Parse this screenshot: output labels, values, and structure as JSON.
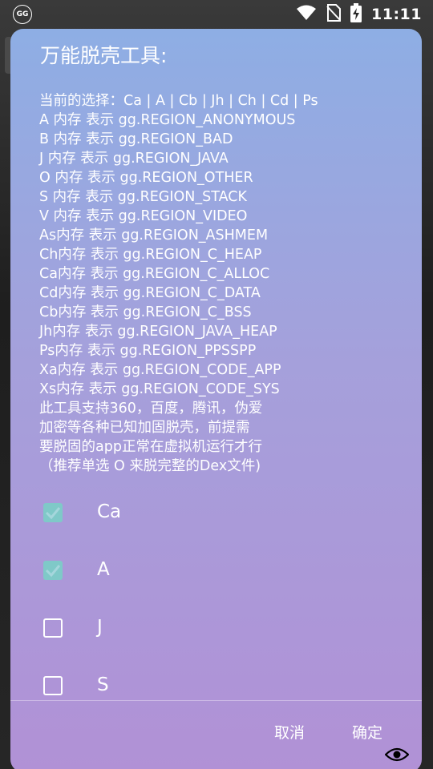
{
  "status_bar": {
    "app_badge": "GG",
    "time": "11:11",
    "icons": [
      "wifi-icon",
      "no-sim-icon",
      "battery-charging-icon"
    ]
  },
  "dialog": {
    "title": "万能脱壳工具:",
    "message_lines": [
      "当前的选择：Ca | A | Cb | Jh | Ch | Cd | Ps",
      "A 内存 表示 gg.REGION_ANONYMOUS",
      "B 内存 表示 gg.REGION_BAD",
      "J 内存 表示 gg.REGION_JAVA",
      "O 内存 表示 gg.REGION_OTHER",
      "S 内存 表示 gg.REGION_STACK",
      "V 内存 表示 gg.REGION_VIDEO",
      "As内存 表示 gg.REGION_ASHMEM",
      "Ch内存 表示 gg.REGION_C_HEAP",
      "Ca内存 表示 gg.REGION_C_ALLOC",
      "Cd内存 表示 gg.REGION_C_DATA",
      "Cb内存 表示 gg.REGION_C_BSS",
      "Jh内存 表示 gg.REGION_JAVA_HEAP",
      "Ps内存 表示 gg.REGION_PPSSPP",
      "Xa内存 表示 gg.REGION_CODE_APP",
      "Xs内存 表示 gg.REGION_CODE_SYS",
      "此工具支持360，百度，腾讯，伪爱",
      "加密等各种已知加固脱壳，前提需",
      "要脱固的app正常在虚拟机运行才行",
      "（推荐单选 O 来脱完整的Dex文件)"
    ],
    "options": [
      {
        "label": "Ca",
        "checked": true
      },
      {
        "label": "A",
        "checked": true
      },
      {
        "label": "J",
        "checked": false
      },
      {
        "label": "S",
        "checked": false
      }
    ],
    "cancel_label": "取消",
    "ok_label": "确定",
    "checkbox_color": "#7fc9c8"
  }
}
